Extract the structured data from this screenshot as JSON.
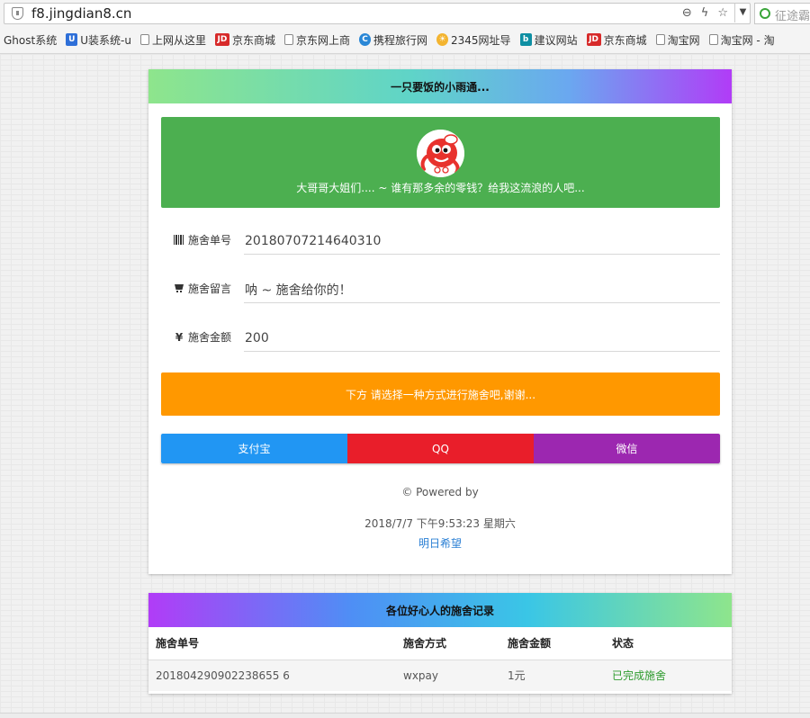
{
  "browser": {
    "url": "f8.jingdian8.cn",
    "search_placeholder": "征途霸",
    "bookmarks": [
      {
        "label": "Ghost系统",
        "icon": "none"
      },
      {
        "label": "U装系统-u",
        "icon": "u-icon"
      },
      {
        "label": "上网从这里",
        "icon": "page-icon"
      },
      {
        "label": "京东商城",
        "icon": "jd-icon"
      },
      {
        "label": "京东网上商",
        "icon": "page-icon"
      },
      {
        "label": "携程旅行网",
        "icon": "ctrip-icon"
      },
      {
        "label": "2345网址导",
        "icon": "sun-icon"
      },
      {
        "label": "建议网站",
        "icon": "b-icon"
      },
      {
        "label": "京东商城",
        "icon": "jd-icon"
      },
      {
        "label": "淘宝网",
        "icon": "page-icon"
      },
      {
        "label": "淘宝网 - 淘",
        "icon": "page-icon"
      }
    ]
  },
  "main": {
    "title": "一只要饭的小雨通...",
    "hero_text": "大哥哥大姐们.... ~ 谁有那多余的零钱？给我这流浪的人吧...",
    "fields": {
      "order": {
        "label": "施舍单号",
        "value": "20180707214640310"
      },
      "message": {
        "label": "施舍留言",
        "value": "呐 ~ 施舍给你的！"
      },
      "amount": {
        "label": "施舍金额",
        "value": "200"
      }
    },
    "notice": "下方 请选择一种方式进行施舍吧,谢谢...",
    "pay_buttons": {
      "alipay": "支付宝",
      "qq": "QQ",
      "wechat": "微信"
    },
    "powered": "© Powered by",
    "timestamp": "2018/7/7 下午9:53:23 星期六",
    "hope_link": "明日希望"
  },
  "records": {
    "title": "各位好心人的施舍记录",
    "columns": [
      "施舍单号",
      "施舍方式",
      "施舍金额",
      "状态"
    ],
    "rows": [
      {
        "order": "201804290902238655 6",
        "method": "wxpay",
        "amount": "1元",
        "status": "已完成施舍"
      }
    ]
  },
  "colors": {
    "hero": "#4caf50",
    "notice": "#ff9800",
    "alipay": "#2196f3",
    "qq": "#e91e2a",
    "wechat": "#9c27b0",
    "status_ok": "#2e9b2e"
  }
}
